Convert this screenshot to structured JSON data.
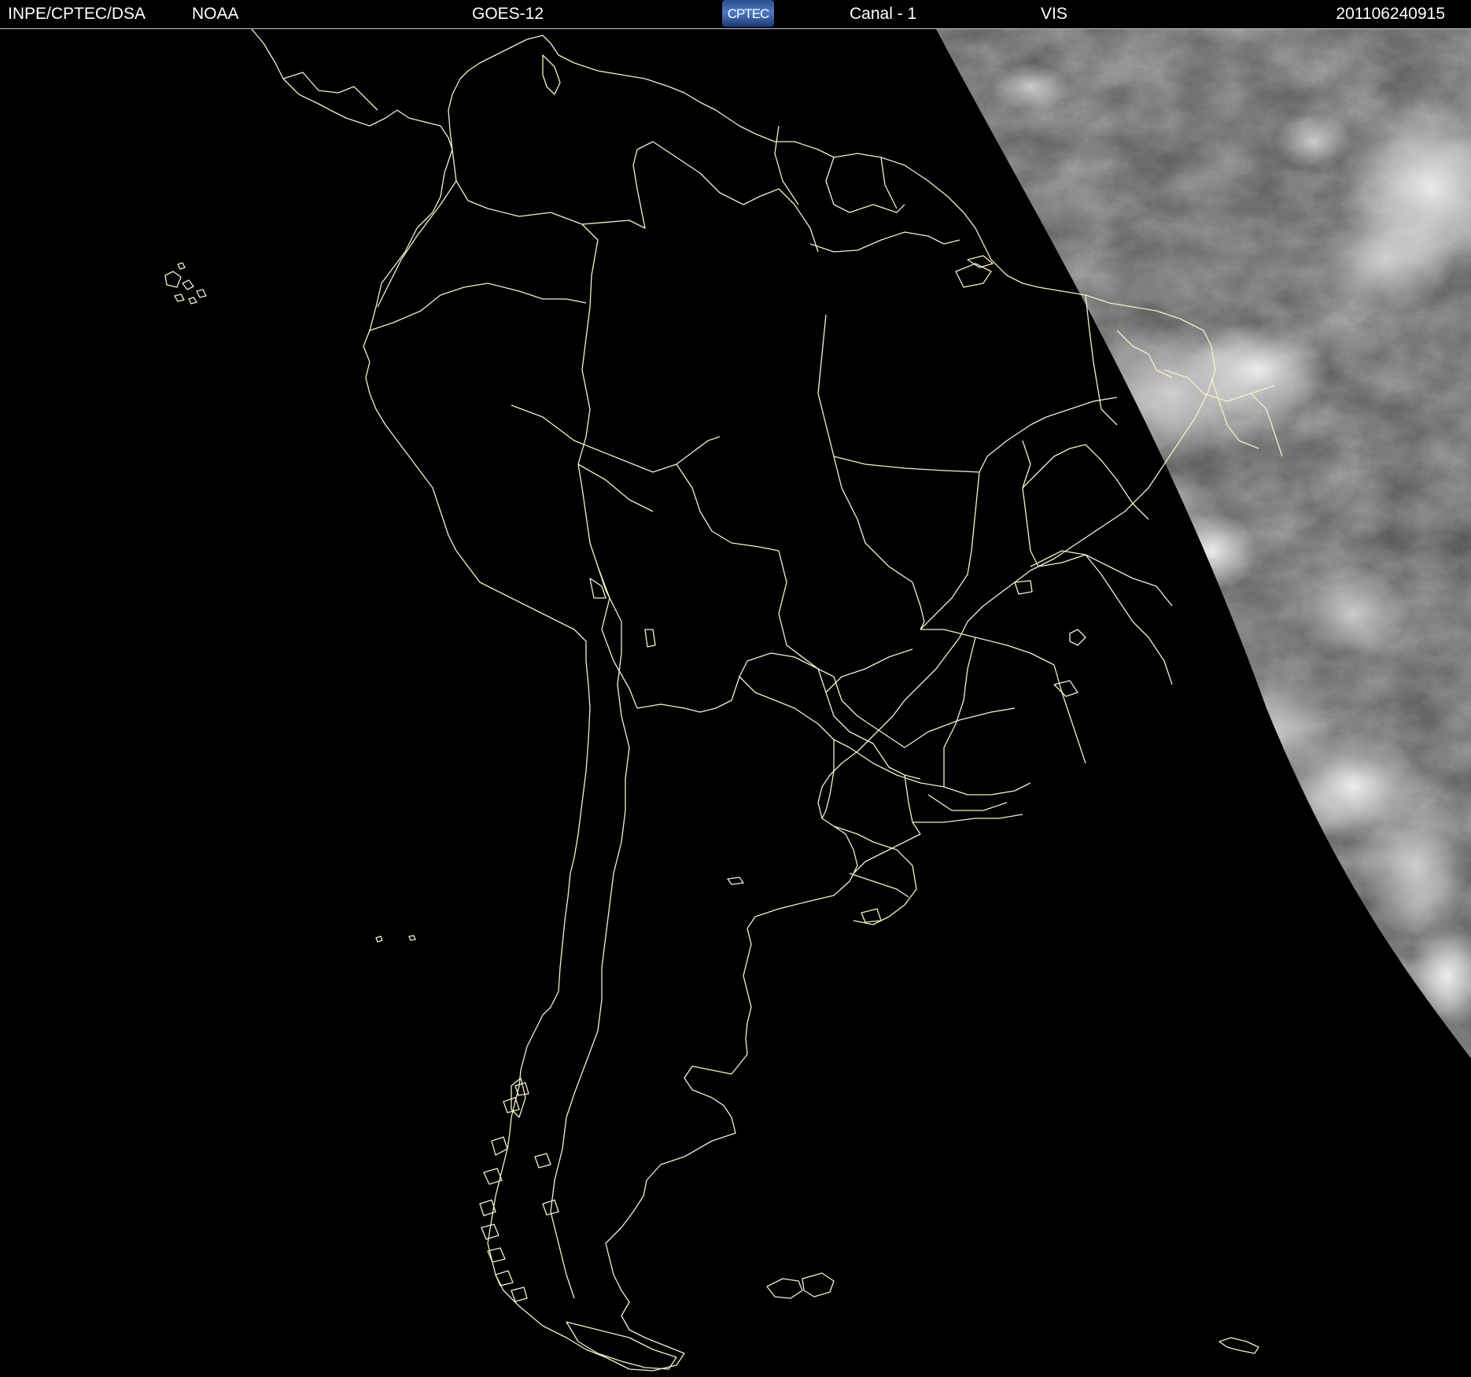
{
  "header": {
    "agency": "INPE/CPTEC/DSA",
    "source": "NOAA",
    "satellite": "GOES-12",
    "logo_text": "CPTEC",
    "channel": "Canal - 1",
    "band": "VIS",
    "timestamp": "201106240915"
  },
  "colors": {
    "background": "#000000",
    "outline": "#f4f2c4",
    "header_text": "#ffffff",
    "cloud_gray": "#6f6f6f",
    "cloud_bright": "#e6e6e6"
  },
  "icons": {
    "logo": "cptec-logo"
  }
}
